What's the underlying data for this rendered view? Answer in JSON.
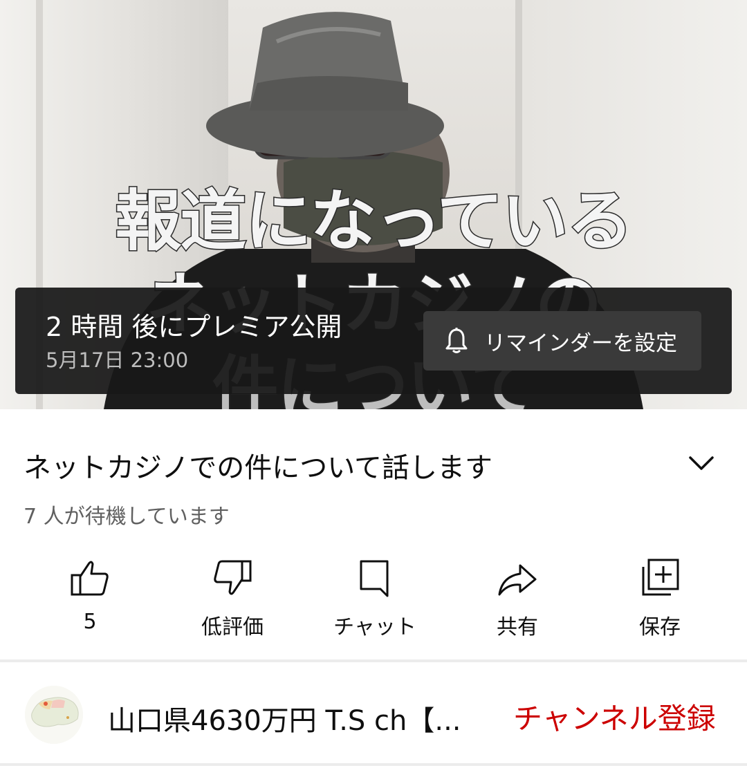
{
  "player": {
    "thumbnail_text": [
      "報道になっている",
      "ネットカジノの",
      "件について"
    ],
    "premiere": {
      "title": "2 時間 後にプレミア公開",
      "date": "5月17日 23:00",
      "reminder_label": "リマインダーを設定",
      "reminder_icon": "bell-icon"
    }
  },
  "video": {
    "title": "ネットカジノでの件について話します",
    "waiting": "7 人が待機しています",
    "expand_icon": "chevron-down-icon"
  },
  "actions": [
    {
      "icon": "thumbs-up-icon",
      "label": "5"
    },
    {
      "icon": "thumbs-down-icon",
      "label": "低評価"
    },
    {
      "icon": "chat-icon",
      "label": "チャット"
    },
    {
      "icon": "share-icon",
      "label": "共有"
    },
    {
      "icon": "save-playlist-icon",
      "label": "保存"
    }
  ],
  "channel": {
    "name": "山口県4630万円 T.S ch【...",
    "subscribe_label": "チャンネル登録",
    "subscribe_color": "#cc0000"
  }
}
